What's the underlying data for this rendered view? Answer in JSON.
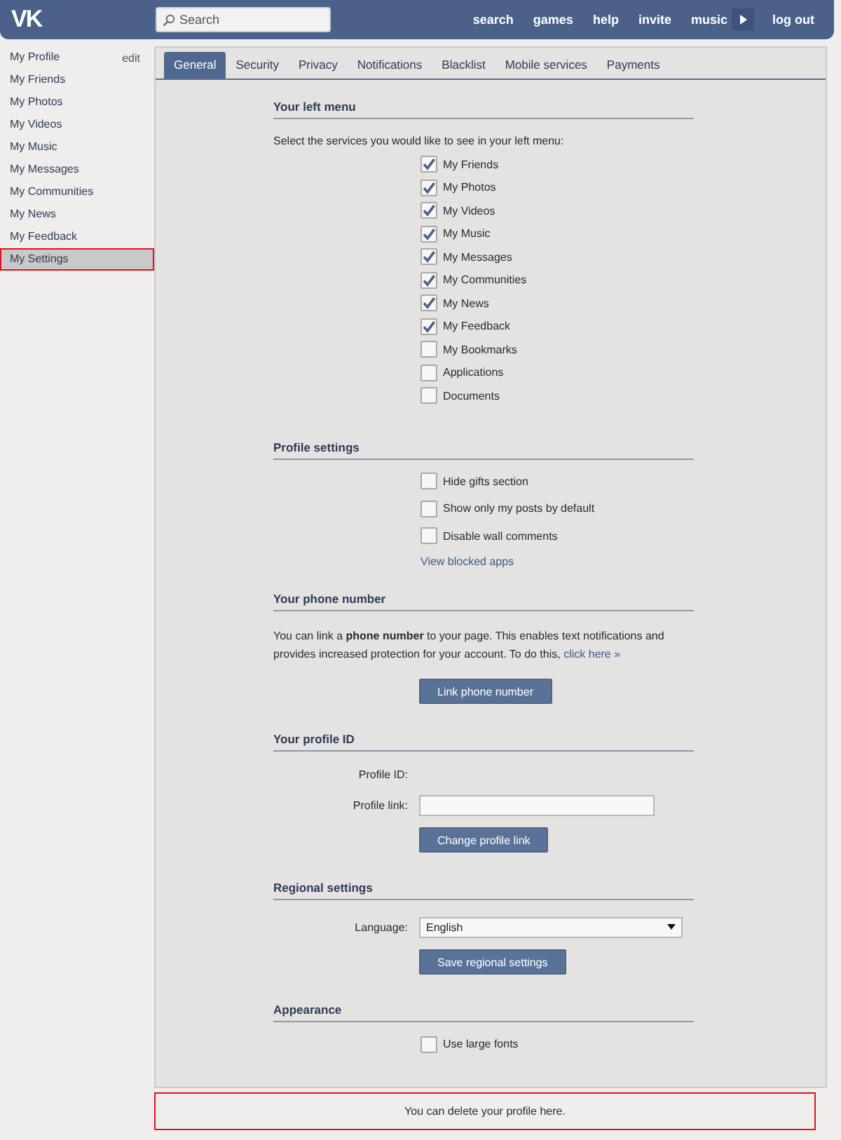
{
  "header": {
    "logo": "VK",
    "search": {
      "placeholder": "Search"
    },
    "links": [
      "search",
      "games",
      "help",
      "invite",
      "music"
    ],
    "logout": "log out"
  },
  "sidebar": {
    "items": [
      {
        "label": "My Profile",
        "edit_link": "edit",
        "selected": false,
        "highlighted": false
      },
      {
        "label": "My Friends",
        "selected": false,
        "highlighted": false
      },
      {
        "label": "My Photos",
        "selected": false,
        "highlighted": false
      },
      {
        "label": "My Videos",
        "selected": false,
        "highlighted": false
      },
      {
        "label": "My Music",
        "selected": false,
        "highlighted": false
      },
      {
        "label": "My Messages",
        "selected": false,
        "highlighted": false
      },
      {
        "label": "My Communities",
        "selected": false,
        "highlighted": false
      },
      {
        "label": "My News",
        "selected": false,
        "highlighted": false
      },
      {
        "label": "My Feedback",
        "selected": false,
        "highlighted": false
      },
      {
        "label": "My Settings",
        "selected": true,
        "highlighted": true
      }
    ]
  },
  "tabs": [
    {
      "label": "General",
      "selected": true
    },
    {
      "label": "Security",
      "selected": false
    },
    {
      "label": "Privacy",
      "selected": false
    },
    {
      "label": "Notifications",
      "selected": false
    },
    {
      "label": "Blacklist",
      "selected": false
    },
    {
      "label": "Mobile services",
      "selected": false
    },
    {
      "label": "Payments",
      "selected": false
    }
  ],
  "sections": [
    {
      "kind": "menu_options",
      "title": "Your left menu",
      "intro": "Select the services you would like to see in your left menu:",
      "options": [
        {
          "label": "My Friends",
          "checked": true
        },
        {
          "label": "My Photos",
          "checked": true
        },
        {
          "label": "My Videos",
          "checked": true
        },
        {
          "label": "My Music",
          "checked": true
        },
        {
          "label": "My Messages",
          "checked": true
        },
        {
          "label": "My Communities",
          "checked": true
        },
        {
          "label": "My News",
          "checked": true
        },
        {
          "label": "My Feedback",
          "checked": true
        },
        {
          "label": "My Bookmarks",
          "checked": false
        },
        {
          "label": "Applications",
          "checked": false
        },
        {
          "label": "Documents",
          "checked": false
        }
      ]
    },
    {
      "kind": "options",
      "title": "Profile settings",
      "options": [
        {
          "label": "Hide gifts section",
          "checked": false
        },
        {
          "label": "Show only my posts by default",
          "checked": false
        },
        {
          "label": "Disable wall comments",
          "checked": false
        }
      ],
      "link": "View blocked apps"
    },
    {
      "kind": "text",
      "title": "Your phone number",
      "text": "You can link a **phone number** to your page. This enables text notifications and provides increased protection for your account. To do this,",
      "link": "click here »",
      "button": "Link phone number"
    },
    {
      "kind": "form",
      "title": "Your profile ID",
      "fields": [
        {
          "kind": "text",
          "label": "Profile ID:"
        },
        {
          "kind": "input",
          "label": "Profile link:"
        }
      ],
      "button": "Change profile link"
    },
    {
      "kind": "form",
      "title": "Regional settings",
      "fields": [
        {
          "kind": "select",
          "label": "Language:",
          "value": "English"
        }
      ],
      "button": "Save regional settings"
    },
    {
      "kind": "options",
      "title": "Appearance",
      "options": [
        {
          "label": "Use large fonts",
          "checked": false
        }
      ]
    }
  ],
  "footer": {
    "text": "You can delete your profile here.",
    "highlighted": true
  }
}
